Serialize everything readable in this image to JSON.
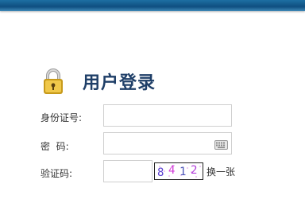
{
  "login": {
    "title": "用户登录",
    "id_label": "身份证号:",
    "id_value": "",
    "id_placeholder": "",
    "password_label": "密  码:",
    "password_value": "",
    "password_placeholder": "",
    "captcha_label": "验证码:",
    "captcha_value": "",
    "captcha_placeholder": "",
    "captcha_text": [
      "8",
      "4",
      "1",
      "2"
    ],
    "refresh_label": "换一张"
  },
  "icons": {
    "lock": "lock-icon",
    "keyboard": "keyboard-icon"
  },
  "colors": {
    "title": "#1f3f68",
    "header_bar": "#0f4f80",
    "captcha_digits": [
      "#5b3fd0",
      "#d23ad8",
      "#4b53b8",
      "#b33fdc"
    ]
  }
}
